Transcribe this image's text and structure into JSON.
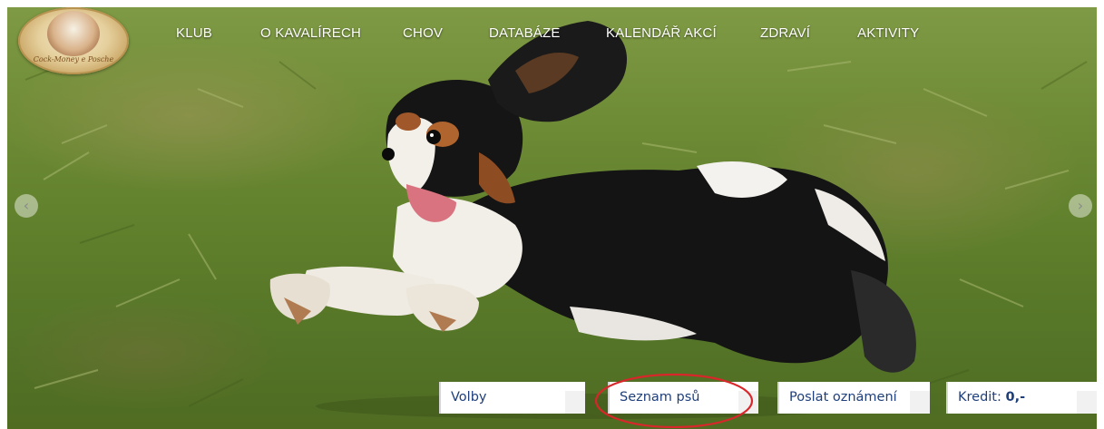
{
  "logo": {
    "motto": "Cock-Money e Posche",
    "icon": "club-logo-dog-icon"
  },
  "nav": {
    "items": [
      {
        "label": "KLUB"
      },
      {
        "label": "O KAVALÍRECH"
      },
      {
        "label": "CHOV"
      },
      {
        "label": "DATABÁZE"
      },
      {
        "label": "KALENDÁŘ AKCÍ"
      },
      {
        "label": "ZDRAVÍ"
      },
      {
        "label": "AKTIVITY"
      }
    ]
  },
  "slider": {
    "prev_icon": "chevron-left-icon",
    "next_icon": "chevron-right-icon",
    "prev_glyph": "‹",
    "next_glyph": "›"
  },
  "actions": {
    "volby": "Volby",
    "seznam": "Seznam psů",
    "poslat": "Poslat oznámení",
    "kredit_label": "Kredit:",
    "kredit_value": "0,-"
  },
  "annotation": {
    "color": "#d9262b"
  },
  "colors": {
    "link_text": "#1f3f7a",
    "nav_text": "#ffffff"
  }
}
